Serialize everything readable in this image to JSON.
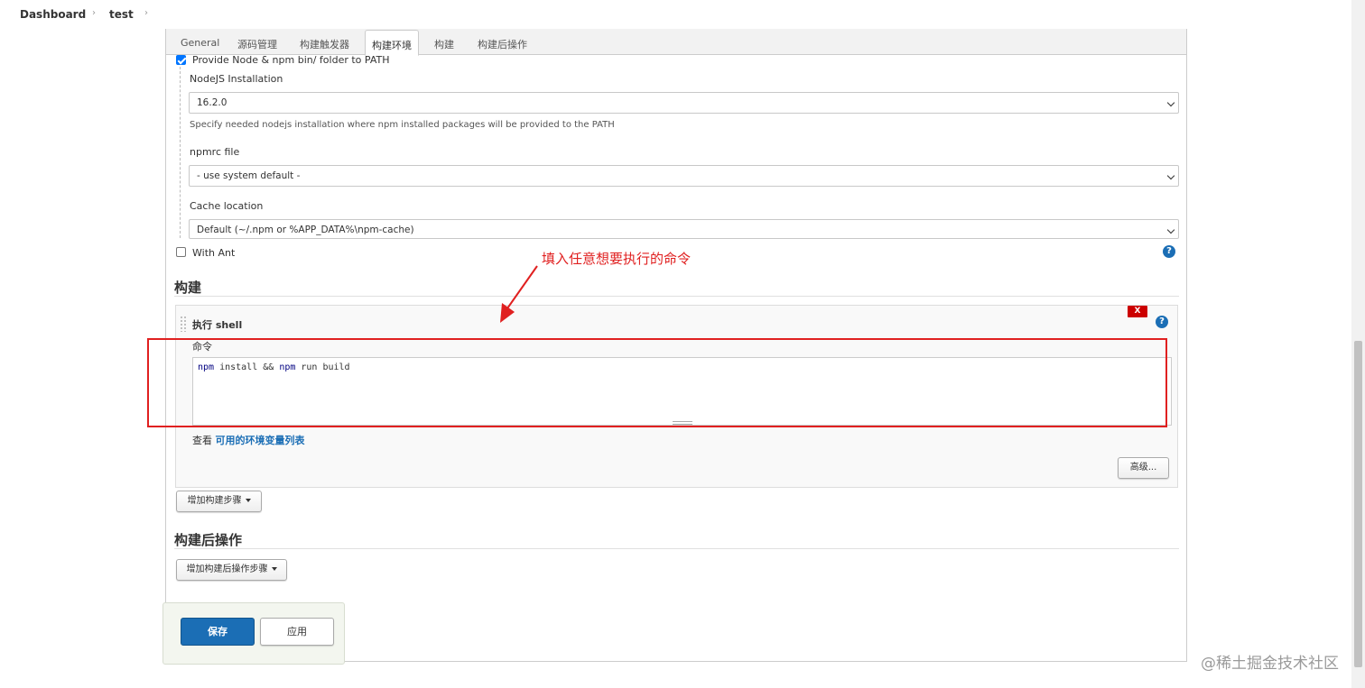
{
  "breadcrumb": {
    "items": [
      "Dashboard",
      "test"
    ]
  },
  "tabs": [
    {
      "label": "General"
    },
    {
      "label": "源码管理"
    },
    {
      "label": "构建触发器"
    },
    {
      "label": "构建环境",
      "active": true
    },
    {
      "label": "构建"
    },
    {
      "label": "构建后操作"
    }
  ],
  "build_env": {
    "provide_node_label": "Provide Node & npm bin/ folder to PATH",
    "provide_node_checked": true,
    "nodejs_installation_label": "NodeJS Installation",
    "nodejs_installation_value": "16.2.0",
    "nodejs_help": "Specify needed nodejs installation where npm installed packages will be provided to the PATH",
    "npmrc_label": "npmrc file",
    "npmrc_value": "- use system default -",
    "cache_label": "Cache location",
    "cache_value": "Default (~/.npm or %APP_DATA%\\npm-cache)",
    "with_ant_label": "With Ant",
    "with_ant_checked": false,
    "help_icon": "?"
  },
  "build": {
    "section_title": "构建",
    "step_title": "执行 shell",
    "delete_label": "X",
    "command_label": "命令",
    "command_keyword": "npm",
    "command_part1": " install && ",
    "command_keyword2": "npm",
    "command_part2": " run build",
    "env_vars_prefix": "查看 ",
    "env_vars_link": "可用的环境变量列表",
    "advanced_button": "高级...",
    "add_step_button": "增加构建步骤"
  },
  "post_build": {
    "section_title": "构建后操作",
    "add_step_button": "增加构建后操作步骤"
  },
  "actions": {
    "save_label": "保存",
    "apply_label": "应用"
  },
  "annotation": {
    "text": "填入任意想要执行的命令",
    "color": "#e02020"
  },
  "watermark": "@稀土掘金技术社区",
  "colors": {
    "primary": "#1b6eb5",
    "danger": "#cc0000",
    "annotation": "#e02020"
  }
}
